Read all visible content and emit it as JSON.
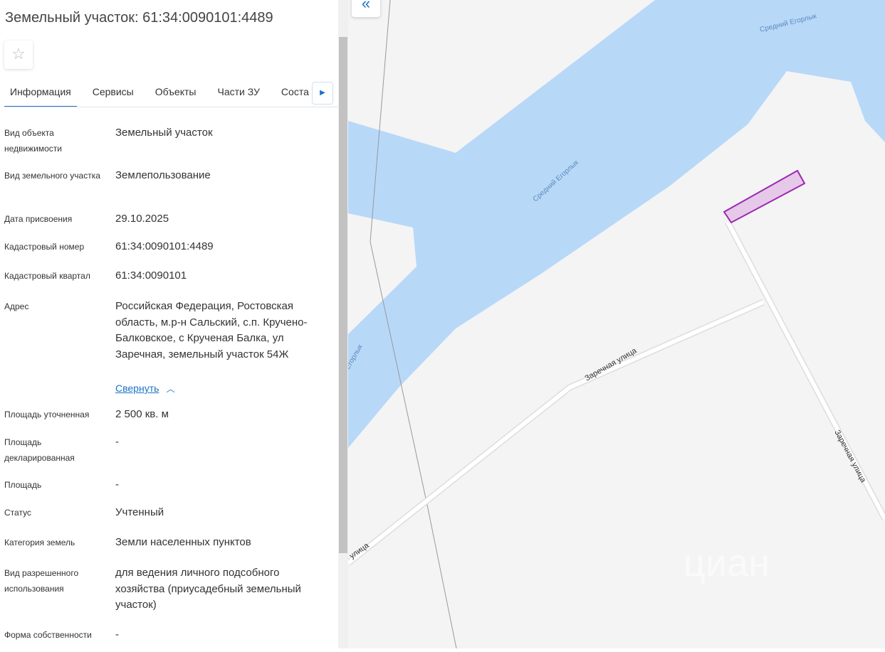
{
  "title": "Земельный участок: 61:34:0090101:4489",
  "tabs": [
    "Информация",
    "Сервисы",
    "Объекты",
    "Части ЗУ",
    "Соста"
  ],
  "fields": [
    {
      "label": "Вид объекта недвижимости",
      "value": "Земельный участок"
    },
    {
      "label": "Вид земельного участка",
      "value": "Землепользование"
    },
    {
      "label": "Дата присвоения",
      "value": "29.10.2025"
    },
    {
      "label": "Кадастровый номер",
      "value": "61:34:0090101:4489"
    },
    {
      "label": "Кадастровый квартал",
      "value": "61:34:0090101"
    },
    {
      "label": "Адрес",
      "value": "Российская Федерация, Ростовская область, м.р-н Сальский, с.п. Кручено-Балковское, с Крученая Балка, ул Заречная, земельный участок 54Ж"
    },
    {
      "label": "Площадь уточненная",
      "value": "2 500 кв. м"
    },
    {
      "label": "Площадь декларированная",
      "value": "-"
    },
    {
      "label": "Площадь",
      "value": "-"
    },
    {
      "label": "Статус",
      "value": "Учтенный"
    },
    {
      "label": "Категория земель",
      "value": "Земли населенных пунктов"
    },
    {
      "label": "Вид разрешенного использования",
      "value": "для ведения личного подсобного хозяйства (приусадебный земельный участок)"
    },
    {
      "label": "Форма собственности",
      "value": "-"
    }
  ],
  "collapse_link": "Свернуть",
  "map": {
    "river_labels": [
      "Средний Егорлык",
      "Средний Егорлык",
      "Егорлык"
    ],
    "street_labels": [
      "Заречная улица",
      "Заречная улица",
      "улица"
    ],
    "watermark": "циан",
    "water_color": "#b8d8f8",
    "parcel_color": "#9c27b0"
  }
}
